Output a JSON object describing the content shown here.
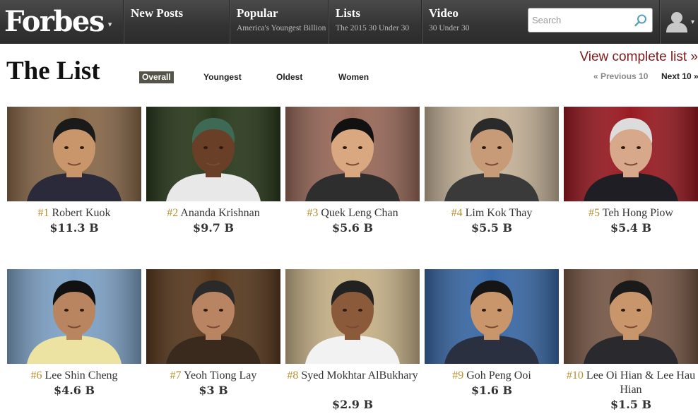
{
  "header": {
    "logo": "Forbes",
    "logo_caret": "▾",
    "nav": [
      {
        "title": "New Posts",
        "subtitle": ""
      },
      {
        "title": "Popular",
        "subtitle": "America's Youngest Billion"
      },
      {
        "title": "Lists",
        "subtitle": "The 2015 30 Under 30"
      },
      {
        "title": "Video",
        "subtitle": "30 Under 30"
      }
    ],
    "search": {
      "placeholder": "Search",
      "value": "",
      "icon": "search-icon"
    },
    "user": {
      "icon": "user-avatar-icon",
      "caret": "▾"
    }
  },
  "list": {
    "title": "The List",
    "filters": [
      {
        "label": "Overall",
        "active": true
      },
      {
        "label": "Youngest",
        "active": false
      },
      {
        "label": "Oldest",
        "active": false
      },
      {
        "label": "Women",
        "active": false
      }
    ],
    "view_complete": "View complete list »",
    "prev": "« Previous 10",
    "next": "Next 10 »"
  },
  "people": [
    {
      "rank": "#1",
      "name": "Robert Kuok",
      "worth": "$11.3 B",
      "bg": "#8a6a4a",
      "skin": "#c9956a",
      "hair": "#1a1a1a",
      "suit": "#2a2a3a"
    },
    {
      "rank": "#2",
      "name": "Ananda Krishnan",
      "worth": "$9.7 B",
      "bg": "#2a3a1c",
      "skin": "#6a3f28",
      "hair": "#3e6a55",
      "suit": "#e8e8e8"
    },
    {
      "rank": "#3",
      "name": "Quek Leng Chan",
      "worth": "$5.6 B",
      "bg": "#9a6a5a",
      "skin": "#d9a880",
      "hair": "#111111",
      "suit": "#2e2e2e"
    },
    {
      "rank": "#4",
      "name": "Lim Kok Thay",
      "worth": "$5.5 B",
      "bg": "#c7b49a",
      "skin": "#c79a78",
      "hair": "#2a2a2a",
      "suit": "#3a3a3a"
    },
    {
      "rank": "#5",
      "name": "Teh Hong Piow",
      "worth": "$5.4 B",
      "bg": "#9a1a22",
      "skin": "#d8a88a",
      "hair": "#dcdcdc",
      "suit": "#1e1e24"
    },
    {
      "rank": "#6",
      "name": "Lee Shin Cheng",
      "worth": "$4.6 B",
      "bg": "#7fa3c8",
      "skin": "#b98560",
      "hair": "#111111",
      "suit": "#ece3a2"
    },
    {
      "rank": "#7",
      "name": "Yeoh Tiong Lay",
      "worth": "$3 B",
      "bg": "#5a3a1e",
      "skin": "#b98462",
      "hair": "#2a2a2a",
      "suit": "#3a2a1e"
    },
    {
      "rank": "#8",
      "name": "Syed Mokhtar AlBukhary",
      "worth": "$2.9 B",
      "bg": "#c9b48a",
      "skin": "#8a5a3a",
      "hair": "#222222",
      "suit": "#f2f2f2"
    },
    {
      "rank": "#9",
      "name": "Goh Peng Ooi",
      "worth": "$1.6 B",
      "bg": "#3a6aa8",
      "skin": "#c9956a",
      "hair": "#151515",
      "suit": "#2a3040"
    },
    {
      "rank": "#10",
      "name": "Lee Oi Hian & Lee Hau Hian",
      "worth": "$1.5 B",
      "bg": "#7a5a48",
      "skin": "#c9956a",
      "hair": "#1a1a1a",
      "suit": "#2a2a2e"
    }
  ],
  "colors": {
    "accent_rank": "#b5912f",
    "link": "#7d1a1a",
    "nav_bg": "#383838",
    "active_filter": "#545448"
  }
}
